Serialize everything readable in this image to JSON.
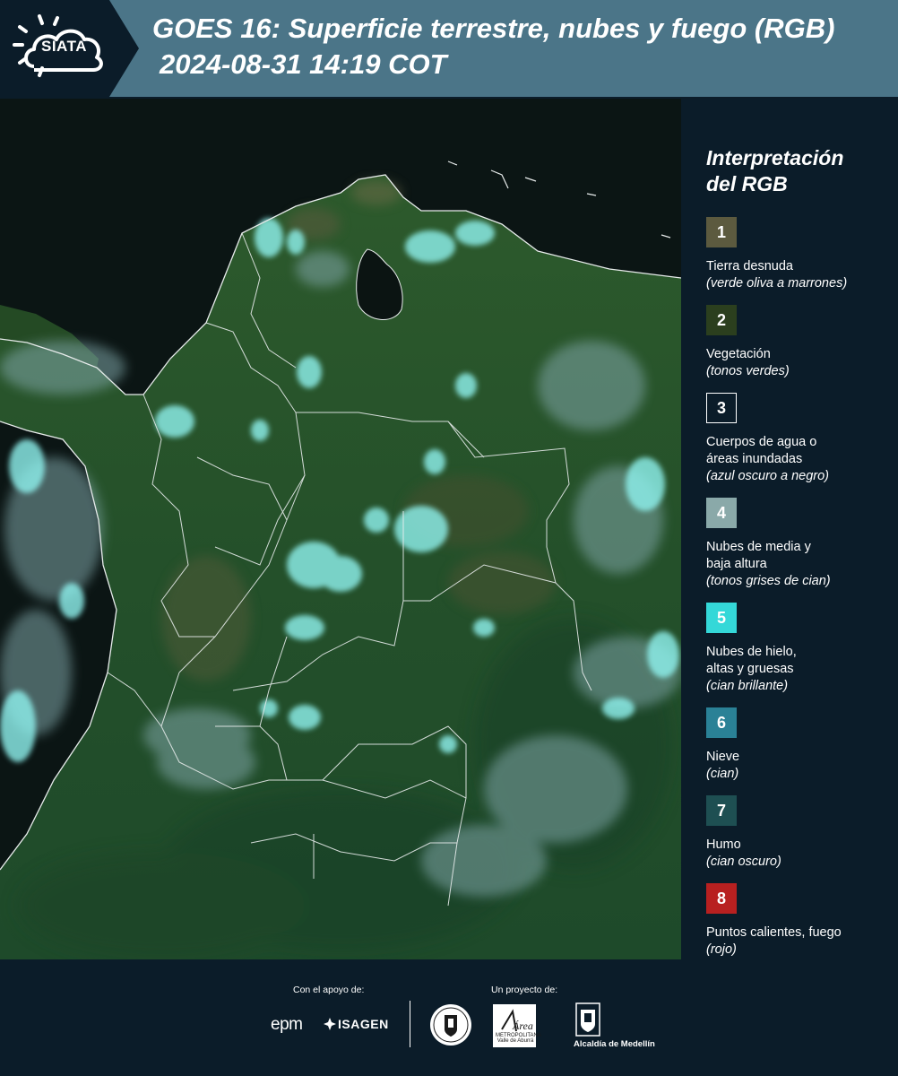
{
  "header": {
    "logo_text": "SIATA",
    "title_line1": "GOES 16: Superficie terrestre, nubes y fuego (RGB)",
    "title_line2": "2024-08-31 14:19 COT"
  },
  "legend": {
    "title_line1": "Interpretación",
    "title_line2": "del RGB",
    "items": [
      {
        "number": "1",
        "label": "Tierra desnuda",
        "desc": "(verde oliva a marrones)",
        "color": "#5c5a3f",
        "border": "#5c5a3f"
      },
      {
        "number": "2",
        "label": "Vegetación",
        "desc": "(tonos verdes)",
        "color": "#2b3f1e",
        "border": "#2b3f1e"
      },
      {
        "number": "3",
        "label": "Cuerpos de agua o áreas inundadas",
        "desc": "(azul oscuro a negro)",
        "color": "#0b1c29",
        "border": "#ffffff"
      },
      {
        "number": "4",
        "label": "Nubes de media y baja altura",
        "desc": "(tonos grises de cian)",
        "color": "#8aa9a9",
        "border": "#8aa9a9"
      },
      {
        "number": "5",
        "label": "Nubes de hielo, altas y gruesas",
        "desc": "(cian brillante)",
        "color": "#34d8d8",
        "border": "#34d8d8"
      },
      {
        "number": "6",
        "label": "Nieve",
        "desc": "(cian)",
        "color": "#2a8196",
        "border": "#2a8196"
      },
      {
        "number": "7",
        "label": "Humo",
        "desc": "(cian oscuro)",
        "color": "#1e4f52",
        "border": "#1e4f52"
      },
      {
        "number": "8",
        "label": "Puntos calientes, fuego",
        "desc": "(rojo)",
        "color": "#b82020",
        "border": "#b82020"
      }
    ]
  },
  "footer": {
    "support_label": "Con el apoyo de:",
    "project_label": "Un proyecto de:",
    "sponsor_1": "epm",
    "sponsor_2": "ISAGEN",
    "partner_area": "Área",
    "partner_area_sub": "METROPOLITANA Valle de Aburrá",
    "partner_alcaldia": "Alcaldía de Medellín"
  },
  "colors": {
    "header_bg": "#4b7588",
    "logo_bg": "#0b1c29",
    "page_bg": "#0b1c29",
    "boundary_line": "#e8ecec"
  }
}
